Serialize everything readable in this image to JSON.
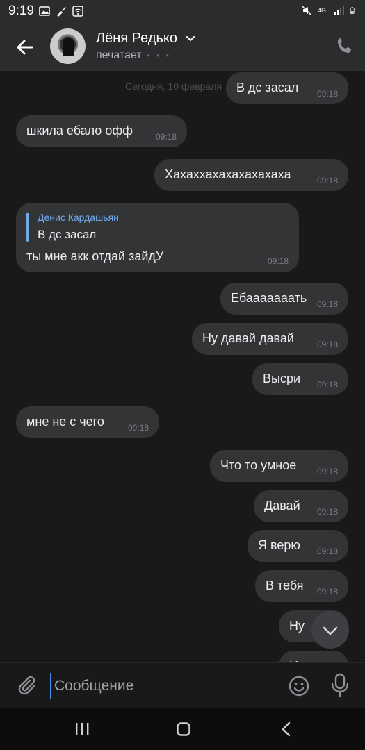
{
  "status_bar": {
    "time": "9:19",
    "network": "4G"
  },
  "header": {
    "contact_name": "Лёня Редько",
    "status": "печатает",
    "typing_dots": "• • •"
  },
  "chat": {
    "date": "Сегодня, 10 февраля",
    "messages": [
      {
        "side": "out",
        "text": "В дс засал",
        "time": "09:18"
      },
      {
        "side": "in",
        "text": "шкила ебало офф",
        "time": "09:18"
      },
      {
        "side": "out",
        "text": "Хахаххахахахахахаха",
        "time": "09:18"
      },
      {
        "side": "in",
        "reply_to_author": "Денис Кардашьян",
        "reply_to_text": "В дс засал",
        "text": "ты мне акк отдай зайдУ",
        "time": "09:18"
      },
      {
        "side": "out",
        "text": "Ебааааааать",
        "time": "09:18"
      },
      {
        "side": "out",
        "text": "Ну давай давай",
        "time": "09:18"
      },
      {
        "side": "out",
        "text": "Высри",
        "time": "09:18"
      },
      {
        "side": "in",
        "text": "мне не с чего",
        "time": "09:18"
      },
      {
        "side": "out",
        "text": "Что то умное",
        "time": "09:18"
      },
      {
        "side": "out",
        "text": "Давай",
        "time": "09:18"
      },
      {
        "side": "out",
        "text": "Я верю",
        "time": "09:18"
      },
      {
        "side": "out",
        "text": "В тебя",
        "time": "09:18"
      },
      {
        "side": "out",
        "text": "Ну",
        "time": ""
      },
      {
        "side": "out",
        "text": "Н",
        "time": ""
      }
    ]
  },
  "composer": {
    "placeholder": "Сообщение"
  },
  "icons": {
    "back": "arrow-left-icon",
    "call": "phone-icon",
    "attach": "paperclip-icon",
    "emoji": "smile-icon",
    "mic": "microphone-icon",
    "scroll": "chevron-down-icon"
  },
  "colors": {
    "accent": "#71aaeb",
    "bubble": "#333436",
    "background": "#19191a"
  }
}
